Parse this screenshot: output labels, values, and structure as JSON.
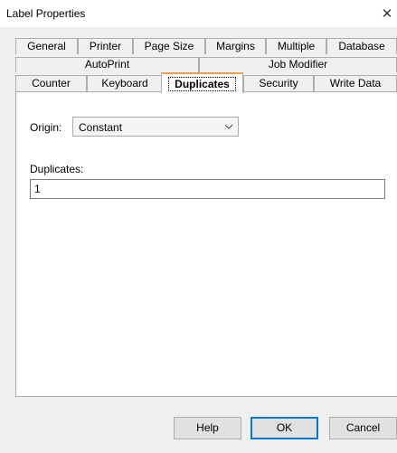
{
  "window": {
    "title": "Label Properties",
    "close_glyph": "✕"
  },
  "tabs": {
    "row1": [
      "General",
      "Printer",
      "Page Size",
      "Margins",
      "Multiple",
      "Database"
    ],
    "row2": [
      "AutoPrint",
      "Job Modifier"
    ],
    "row3": [
      "Counter",
      "Keyboard",
      "Duplicates",
      "Security",
      "Write Data"
    ],
    "active": "Duplicates"
  },
  "content": {
    "origin_label": "Origin:",
    "origin_value": "Constant",
    "duplicates_label": "Duplicates:",
    "duplicates_value": "1"
  },
  "buttons": {
    "help": "Help",
    "ok": "OK",
    "cancel": "Cancel"
  },
  "colors": {
    "dialog_bg": "#f0f0f0",
    "panel_bg": "#ffffff",
    "active_tab_accent": "#f0a050",
    "default_button_border": "#0078d7"
  },
  "icons": {
    "close": "close-icon",
    "dropdown": "chevron-down-icon"
  }
}
